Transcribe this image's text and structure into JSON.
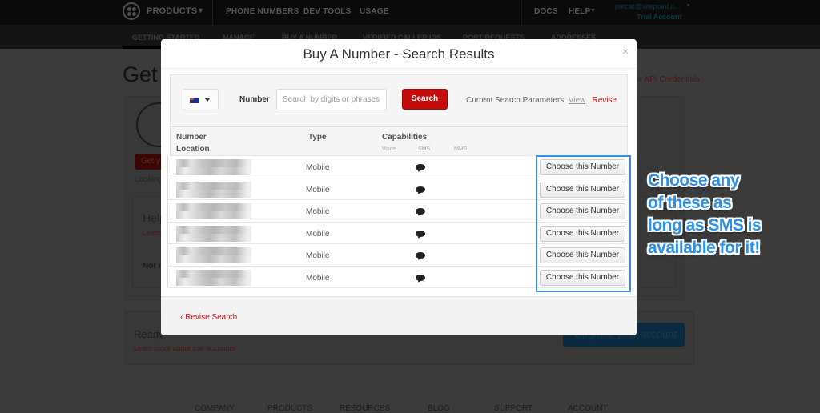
{
  "topnav": {
    "products": "PRODUCTS",
    "items": [
      "PHONE NUMBERS",
      "DEV TOOLS",
      "USAGE"
    ],
    "docs": "DOCS",
    "help": "HELP",
    "user_email": "patcat@sitepoint.c...",
    "account_type": "Trial Account"
  },
  "subnav": {
    "items": [
      "GETTING STARTED",
      "MANAGE",
      "BUY A NUMBER",
      "VERIFIED CALLER IDS",
      "PORT REQUESTS",
      "ADDRESSES"
    ]
  },
  "background_page": {
    "title": "Get",
    "api_link": "w API Credentials",
    "get_button": "Get y",
    "looking": "Looking",
    "help_title": "Help",
    "learn": "Learn",
    "not_ready": "Not r",
    "ready_text": "Ready",
    "learn_trial": "Learn more about trial accounts",
    "upgrade_button": "Upgrade your account",
    "footer": [
      "COMPANY",
      "PRODUCTS",
      "RESOURCES",
      "BLOG",
      "SUPPORT",
      "ACCOUNT"
    ]
  },
  "modal": {
    "title": "Buy A Number - Search Results",
    "close": "×",
    "search": {
      "country_icon": "australia-flag-icon",
      "number_label": "Number",
      "placeholder": "Search by digits or phrases",
      "value": "",
      "button": "Search",
      "params_label": "Current Search Parameters:",
      "view": "View",
      "separator": "|",
      "revise": "Revise"
    },
    "table": {
      "headers": {
        "number": "Number",
        "location": "Location",
        "type": "Type",
        "capabilities": "Capabilities",
        "voice": "Voice",
        "sms": "SMS",
        "mms": "MMS"
      },
      "rows": [
        {
          "number": "[redacted]",
          "type": "Mobile",
          "voice": false,
          "sms": true,
          "mms": false,
          "action": "Choose this Number"
        },
        {
          "number": "[redacted]",
          "type": "Mobile",
          "voice": false,
          "sms": true,
          "mms": false,
          "action": "Choose this Number"
        },
        {
          "number": "[redacted]",
          "type": "Mobile",
          "voice": false,
          "sms": true,
          "mms": false,
          "action": "Choose this Number"
        },
        {
          "number": "[redacted]",
          "type": "Mobile",
          "voice": false,
          "sms": true,
          "mms": false,
          "action": "Choose this Number"
        },
        {
          "number": "[redacted]",
          "type": "Mobile",
          "voice": false,
          "sms": true,
          "mms": false,
          "action": "Choose this Number"
        },
        {
          "number": "[redacted]",
          "type": "Mobile",
          "voice": false,
          "sms": true,
          "mms": false,
          "action": "Choose this Number"
        }
      ]
    },
    "footer": {
      "revise_search": "Revise Search"
    }
  },
  "annotation": {
    "lines": [
      "Choose any",
      "of these as",
      "long as SMS is",
      "available for it!"
    ],
    "color": "#2d8fe8"
  },
  "colors": {
    "brand_red": "#c60b0b",
    "highlight_blue": "#3a8fe0"
  }
}
